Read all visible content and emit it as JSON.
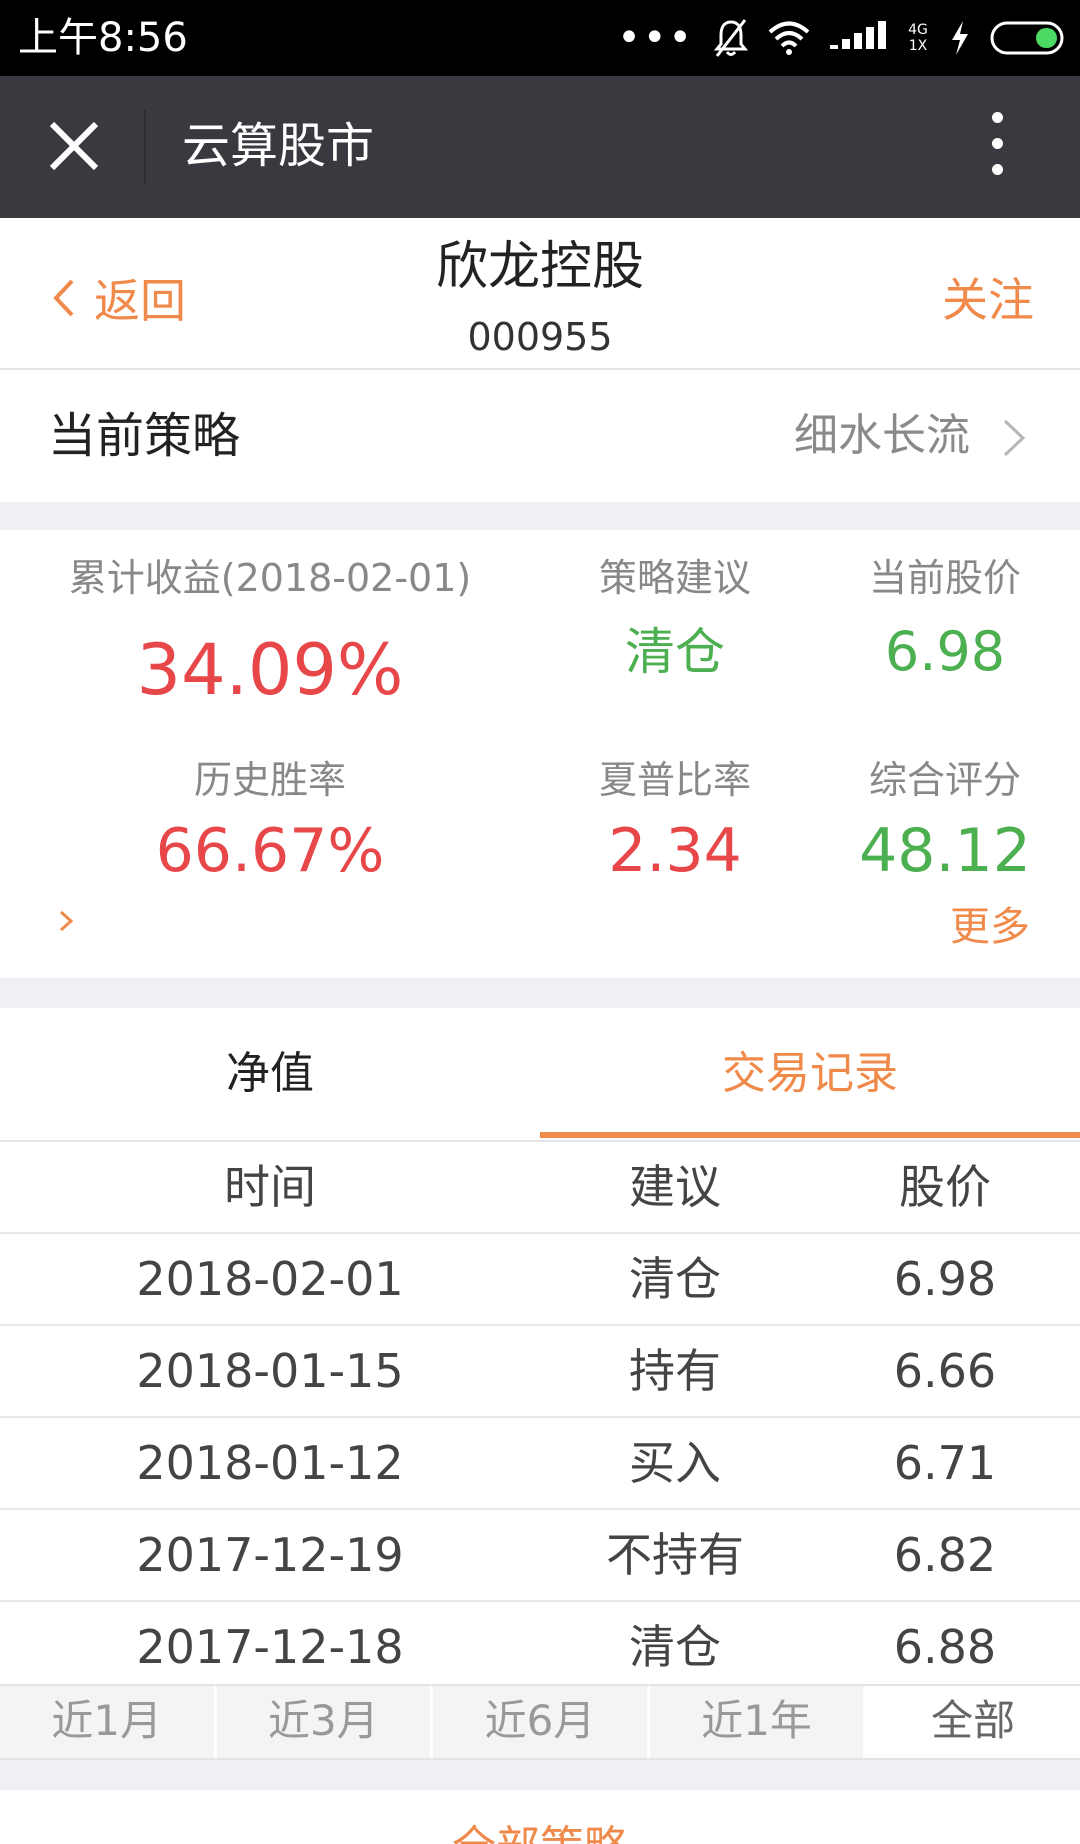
{
  "status_bar": {
    "time": "上午8:56",
    "network": "4G 1X",
    "icons": [
      "more-dots-icon",
      "bell-off-icon",
      "wifi-icon",
      "signal-icon",
      "charging-icon",
      "battery-icon"
    ]
  },
  "navbar": {
    "title": "云算股市",
    "icons": [
      "close-icon",
      "more-vertical-icon"
    ]
  },
  "header": {
    "back_label": "返回",
    "stock_name": "欣龙控股",
    "stock_code": "000955",
    "follow_label": "关注"
  },
  "strategy": {
    "label": "当前策略",
    "value": "细水长流"
  },
  "stats": {
    "cumulative_return": {
      "label": "累计收益(2018-02-01)",
      "value": "34.09%"
    },
    "advice": {
      "label": "策略建议",
      "value": "清仓"
    },
    "current_price": {
      "label": "当前股价",
      "value": "6.98"
    },
    "win_rate": {
      "label": "历史胜率",
      "value": "66.67%"
    },
    "sharpe": {
      "label": "夏普比率",
      "value": "2.34"
    },
    "score": {
      "label": "综合评分",
      "value": "48.12"
    },
    "more_label": "更多"
  },
  "tabs": {
    "items": [
      {
        "label": "净值",
        "active": false
      },
      {
        "label": "交易记录",
        "active": true
      }
    ]
  },
  "records": {
    "headers": [
      "时间",
      "建议",
      "股价"
    ],
    "rows": [
      [
        "2018-02-01",
        "清仓",
        "6.98"
      ],
      [
        "2018-01-15",
        "持有",
        "6.66"
      ],
      [
        "2018-01-12",
        "买入",
        "6.71"
      ],
      [
        "2017-12-19",
        "不持有",
        "6.82"
      ],
      [
        "2017-12-18",
        "清仓",
        "6.88"
      ]
    ]
  },
  "periods": {
    "items": [
      "近1月",
      "近3月",
      "近6月",
      "近1年",
      "全部"
    ],
    "active": "全部"
  },
  "bottom": {
    "label": "全部策略"
  },
  "colors": {
    "accent": "#f08a4b",
    "up_red": "#e8474a",
    "green": "#4caf50",
    "navbar": "#393a3f"
  }
}
